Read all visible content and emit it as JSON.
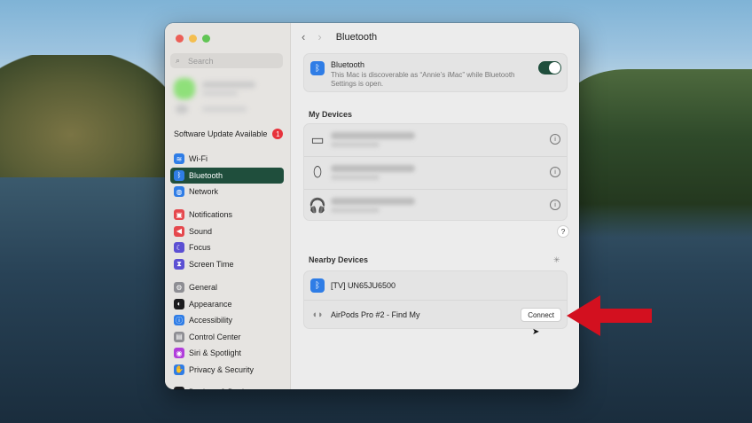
{
  "sidebar": {
    "search_placeholder": "Search",
    "software_update": "Software Update Available",
    "update_count": "1",
    "groups": [
      [
        {
          "label": "Wi-Fi",
          "icon": "wifi-icon",
          "color": "#2f7de6",
          "glyph": "≋"
        },
        {
          "label": "Bluetooth",
          "icon": "bluetooth-icon",
          "color": "#2f7de6",
          "glyph": "ᛒ",
          "active": true
        },
        {
          "label": "Network",
          "icon": "globe-icon",
          "color": "#2f7de6",
          "glyph": "◍"
        }
      ],
      [
        {
          "label": "Notifications",
          "icon": "bell-icon",
          "color": "#e5484d",
          "glyph": "▣"
        },
        {
          "label": "Sound",
          "icon": "speaker-icon",
          "color": "#e5484d",
          "glyph": "◀"
        },
        {
          "label": "Focus",
          "icon": "moon-icon",
          "color": "#5b4fd3",
          "glyph": "☾"
        },
        {
          "label": "Screen Time",
          "icon": "hourglass-icon",
          "color": "#5b4fd3",
          "glyph": "⧗"
        }
      ],
      [
        {
          "label": "General",
          "icon": "gear-icon",
          "color": "#8e8e93",
          "glyph": "⚙"
        },
        {
          "label": "Appearance",
          "icon": "appearance-icon",
          "color": "#1c1c1e",
          "glyph": "◐"
        },
        {
          "label": "Accessibility",
          "icon": "accessibility-icon",
          "color": "#2f7de6",
          "glyph": "ⓘ"
        },
        {
          "label": "Control Center",
          "icon": "control-center-icon",
          "color": "#8e8e93",
          "glyph": "▤"
        },
        {
          "label": "Siri & Spotlight",
          "icon": "siri-icon",
          "color": "#b13ddb",
          "glyph": "◉"
        },
        {
          "label": "Privacy & Security",
          "icon": "hand-icon",
          "color": "#2f7de6",
          "glyph": "✋"
        }
      ],
      [
        {
          "label": "Desktop & Dock",
          "icon": "dock-icon",
          "color": "#1c1c1e",
          "glyph": "▭"
        }
      ]
    ]
  },
  "toolbar": {
    "title": "Bluetooth",
    "back": "‹",
    "forward": "›"
  },
  "bluetooth": {
    "label": "Bluetooth",
    "description": "This Mac is discoverable as “Annie’s iMac” while Bluetooth Settings is open.",
    "enabled": true
  },
  "my_devices": {
    "title": "My Devices",
    "rows": [
      {
        "icon": "keyboard-icon",
        "glyph": "▭"
      },
      {
        "icon": "mouse-icon",
        "glyph": "⬯"
      },
      {
        "icon": "headphones-icon",
        "glyph": "🎧"
      }
    ]
  },
  "help": "?",
  "nearby": {
    "title": "Nearby Devices",
    "rows": [
      {
        "name": "[TV] UN65JU6500",
        "icon": "bluetooth-icon"
      },
      {
        "name": "AirPods Pro #2 - Find My",
        "icon": "airpods-icon",
        "action": "Connect"
      }
    ]
  },
  "colors": {
    "accent": "#1f4e3c",
    "arrow": "#d3101f"
  }
}
